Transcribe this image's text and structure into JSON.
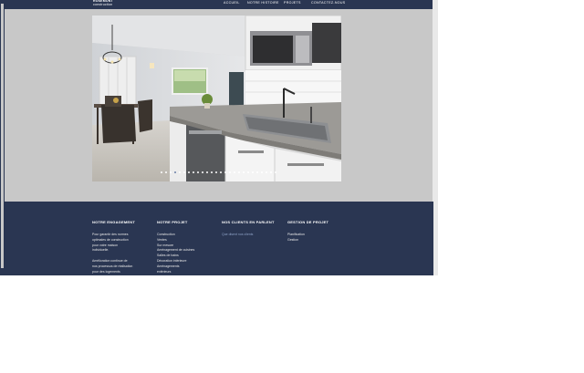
{
  "header": {
    "logo_line1": "ROSEMONT",
    "logo_line2": "construction",
    "nav": [
      "ACCUEIL",
      "NOTRE HISTOIRE",
      "PROJETS",
      "CONTACTEZ-NOUS"
    ]
  },
  "hero": {
    "alt": "Modern kitchen and dining area",
    "slide_count": 26,
    "active_slide": 3
  },
  "footer": {
    "col1": {
      "title": "NOTRE ENGAGEMENT",
      "items": [
        "Pour garantir des normes",
        "optimales de construction",
        "pour votre maison",
        "individuelle.",
        "",
        "Amélioration continue de",
        "nos processus de réalisation",
        "pour des logements"
      ]
    },
    "col2": {
      "title": "NOTRE PROJET",
      "items": [
        "Construction",
        "Ventes",
        "Sur mesure",
        "Aménagement de cuisines",
        "Salles de bains",
        "Décoration intérieure",
        "Aménagements",
        "extérieurs"
      ]
    },
    "col3": {
      "title": "NOS CLIENTS EN PARLENT",
      "items": [
        "Que disent nos clients"
      ]
    },
    "col4": {
      "title": "GESTION DE PROJET",
      "items": [
        "Planification",
        "Gestion"
      ]
    }
  },
  "colors": {
    "navy": "#2a3652",
    "page_bg": "#c8c8c8"
  }
}
